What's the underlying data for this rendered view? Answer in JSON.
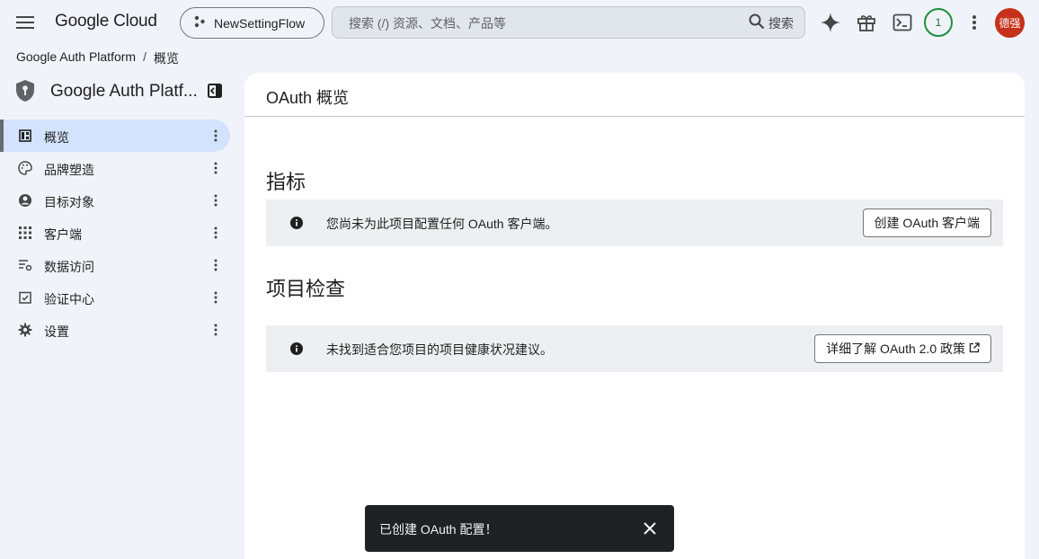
{
  "topbar": {
    "logo": "Google Cloud",
    "project": "NewSettingFlow",
    "search_placeholder": "搜索 (/) 资源、文档、产品等",
    "search_button": "搜索",
    "notification_count": "1",
    "avatar_text": "德强"
  },
  "breadcrumb": {
    "root": "Google Auth Platform",
    "separator": "/",
    "current": "概览"
  },
  "sidebar": {
    "title": "Google Auth Platf...",
    "items": [
      {
        "label": "概览",
        "icon": "dashboard-icon",
        "active": true
      },
      {
        "label": "品牌塑造",
        "icon": "palette-icon",
        "active": false
      },
      {
        "label": "目标对象",
        "icon": "account-circle-icon",
        "active": false
      },
      {
        "label": "客户端",
        "icon": "apps-grid-icon",
        "active": false
      },
      {
        "label": "数据访问",
        "icon": "data-settings-icon",
        "active": false
      },
      {
        "label": "验证中心",
        "icon": "verification-icon",
        "active": false
      },
      {
        "label": "设置",
        "icon": "gear-icon",
        "active": false
      }
    ]
  },
  "main": {
    "title": "OAuth 概览",
    "metrics": {
      "title": "指标",
      "message": "您尚未为此项目配置任何 OAuth 客户端。",
      "button": "创建 OAuth 客户端"
    },
    "checkup": {
      "title": "项目检查",
      "message": "未找到适合您项目的项目健康状况建议。",
      "button": "详细了解 OAuth 2.0 政策"
    }
  },
  "snackbar": {
    "message": "已创建 OAuth 配置！"
  },
  "colors": {
    "background": "#f0f4fa",
    "active_nav": "#d3e3fd",
    "avatar": "#c5311b",
    "notification": "#1e8e3e",
    "snackbar": "#202124"
  }
}
